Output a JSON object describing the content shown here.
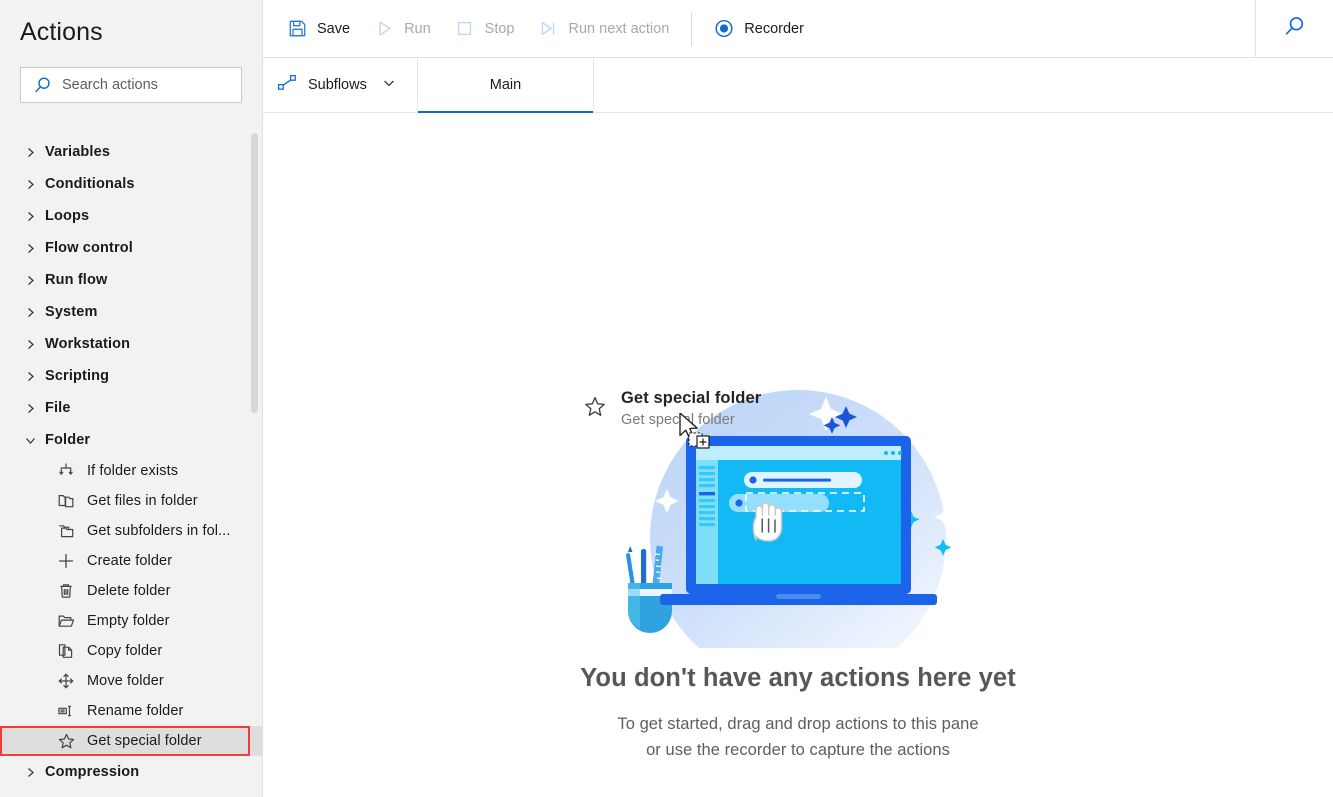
{
  "sidebar": {
    "title": "Actions",
    "search": {
      "placeholder": "Search actions",
      "value": "",
      "icon": "search-icon"
    },
    "groups": [
      {
        "label": "Variables",
        "expanded": false
      },
      {
        "label": "Conditionals",
        "expanded": false
      },
      {
        "label": "Loops",
        "expanded": false
      },
      {
        "label": "Flow control",
        "expanded": false
      },
      {
        "label": "Run flow",
        "expanded": false
      },
      {
        "label": "System",
        "expanded": false
      },
      {
        "label": "Workstation",
        "expanded": false
      },
      {
        "label": "Scripting",
        "expanded": false
      },
      {
        "label": "File",
        "expanded": false
      },
      {
        "label": "Folder",
        "expanded": true
      },
      {
        "label": "Compression",
        "expanded": false
      }
    ],
    "folder_items": [
      {
        "label": "If folder exists",
        "icon": "branch-arrows-icon",
        "selected": false
      },
      {
        "label": "Get files in folder",
        "icon": "folder-files-icon",
        "selected": false
      },
      {
        "label": "Get subfolders in fol...",
        "icon": "subfolders-icon",
        "selected": false
      },
      {
        "label": "Create folder",
        "icon": "plus-icon",
        "selected": false
      },
      {
        "label": "Delete folder",
        "icon": "trash-icon",
        "selected": false
      },
      {
        "label": "Empty folder",
        "icon": "open-folder-icon",
        "selected": false
      },
      {
        "label": "Copy folder",
        "icon": "copy-icon",
        "selected": false
      },
      {
        "label": "Move folder",
        "icon": "move-arrows-icon",
        "selected": false
      },
      {
        "label": "Rename folder",
        "icon": "rename-icon",
        "selected": false
      },
      {
        "label": "Get special folder",
        "icon": "star-icon",
        "selected": true
      }
    ],
    "highlight_color": "#f03c3c"
  },
  "toolbar": {
    "items": [
      {
        "label": "Save",
        "icon": "save-icon",
        "enabled": true
      },
      {
        "label": "Run",
        "icon": "play-icon",
        "enabled": false
      },
      {
        "label": "Stop",
        "icon": "stop-square-icon",
        "enabled": false
      },
      {
        "label": "Run next action",
        "icon": "step-over-icon",
        "enabled": false
      }
    ],
    "recorder": {
      "label": "Recorder",
      "icon": "record-circle-icon",
      "enabled": true
    },
    "search_icon": "search-icon",
    "accent_color": "#0f6cbd"
  },
  "tabbar": {
    "subflows": {
      "label": "Subflows",
      "icon": "subflow-nodes-icon",
      "chevron": "chevron-down-icon"
    },
    "tabs": [
      {
        "label": "Main",
        "active": true
      }
    ]
  },
  "canvas": {
    "drag_item": {
      "title": "Get special folder",
      "subtitle": "Get special folder",
      "icon": "star-icon",
      "cursor": "drag-copy-cursor"
    },
    "empty_state": {
      "illustration": "laptop-drag-drop-illustration",
      "title": "You don't have any actions here yet",
      "line1": "To get started, drag and drop actions to this pane",
      "line2": "or use the recorder to capture the actions"
    }
  }
}
